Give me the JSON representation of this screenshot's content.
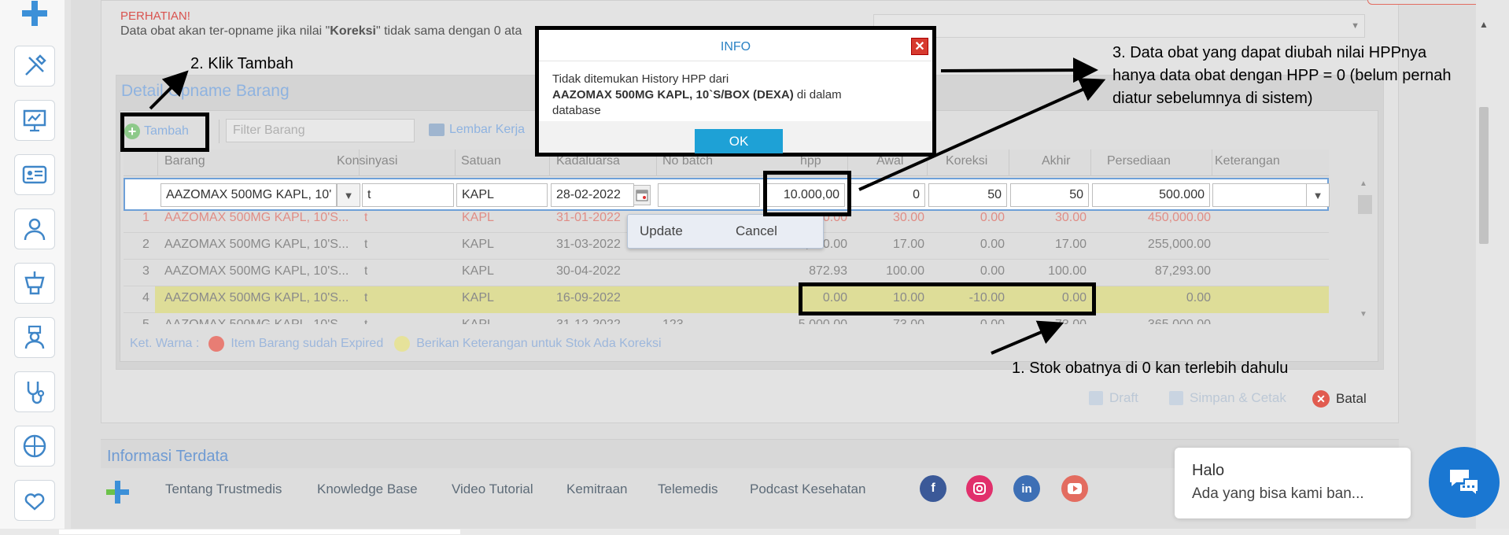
{
  "warning": {
    "title": "PERHATIAN!",
    "text_prefix": "Data obat akan ter-opname jika nilai \"",
    "text_bold": "Koreksi",
    "text_suffix": "\" tidak sama dengan 0 ata"
  },
  "detail_title": "Detail Opname Barang",
  "toolbar": {
    "add_label": "Tambah",
    "filter_placeholder": "Filter Barang",
    "worksheet_label": "Lembar Kerja"
  },
  "columns": [
    "Barang",
    "Konsinyasi",
    "Satuan",
    "Kadaluarsa",
    "No batch",
    "hpp",
    "Awal",
    "Koreksi",
    "Akhir",
    "Persediaan",
    "Keterangan"
  ],
  "edit_row": {
    "barang": "AAZOMAX 500MG KAPL, 10'",
    "konsinyasi": "t",
    "satuan": "KAPL",
    "kadaluarsa": "28-02-2022",
    "no_batch": "",
    "hpp": "10.000,00",
    "awal": "0",
    "koreksi": "50",
    "akhir": "50",
    "persediaan": "500.000",
    "keterangan": ""
  },
  "rows": [
    {
      "no": "1",
      "barang": "AAZOMAX 500MG KAPL, 10'S...",
      "konsinyasi": "t",
      "satuan": "KAPL",
      "kadaluarsa": "31-01-2022",
      "no_batch": "",
      "hpp": ",000.00",
      "awal": "30.00",
      "koreksi": "0.00",
      "akhir": "30.00",
      "persediaan": "450,000.00",
      "style": "red"
    },
    {
      "no": "2",
      "barang": "AAZOMAX 500MG KAPL, 10'S...",
      "konsinyasi": "t",
      "satuan": "KAPL",
      "kadaluarsa": "31-03-2022",
      "no_batch": "",
      "hpp": ",000.00",
      "awal": "17.00",
      "koreksi": "0.00",
      "akhir": "17.00",
      "persediaan": "255,000.00",
      "style": ""
    },
    {
      "no": "3",
      "barang": "AAZOMAX 500MG KAPL, 10'S...",
      "konsinyasi": "t",
      "satuan": "KAPL",
      "kadaluarsa": "30-04-2022",
      "no_batch": "",
      "hpp": "872.93",
      "awal": "100.00",
      "koreksi": "0.00",
      "akhir": "100.00",
      "persediaan": "87,293.00",
      "style": ""
    },
    {
      "no": "4",
      "barang": "AAZOMAX 500MG KAPL, 10'S...",
      "konsinyasi": "t",
      "satuan": "KAPL",
      "kadaluarsa": "16-09-2022",
      "no_batch": "",
      "hpp": "0.00",
      "awal": "10.00",
      "koreksi": "-10.00",
      "akhir": "0.00",
      "persediaan": "0.00",
      "style": "hl"
    },
    {
      "no": "5",
      "barang": "AAZOMAX 500MG KAPL, 10'S...",
      "konsinyasi": "t",
      "satuan": "KAPL",
      "kadaluarsa": "31-12-2022",
      "no_batch": "123",
      "hpp": "5,000.00",
      "awal": "73.00",
      "koreksi": "0.00",
      "akhir": "73.00",
      "persediaan": "365,000.00",
      "style": ""
    }
  ],
  "row_popup": {
    "update": "Update",
    "cancel": "Cancel"
  },
  "legend": {
    "label": "Ket. Warna :",
    "expired": "Item Barang sudah Expired",
    "correction": "Berikan Keterangan untuk Stok Ada Koreksi",
    "expired_color": "#e87d74",
    "correction_color": "#e6e29a"
  },
  "actions": {
    "draft": "Draft",
    "save_print": "Simpan & Cetak",
    "cancel": "Batal"
  },
  "info_section": "Informasi Terdata",
  "footer": {
    "links": [
      "Tentang Trustmedis",
      "Knowledge Base",
      "Video Tutorial",
      "Kemitraan",
      "Telemedis",
      "Podcast Kesehatan"
    ],
    "social": [
      "facebook-icon",
      "instagram-icon",
      "linkedin-icon",
      "youtube-icon"
    ]
  },
  "dialog": {
    "title": "INFO",
    "line1": "Tidak ditemukan History HPP dari",
    "item": "AAZOMAX 500MG KAPL, 10`S/BOX (DEXA)",
    "line2_suffix": " di dalam",
    "line3": "database",
    "ok": "OK"
  },
  "annotations": {
    "step1": "1. Stok obatnya di 0 kan terlebih dahulu",
    "step2": "2. Klik Tambah",
    "step3_l1": "3. Data obat yang dapat diubah nilai HPPnya",
    "step3_l2": "hanya data obat dengan HPP = 0 (belum pernah",
    "step3_l3": "diatur sebelumnya di sistem)"
  },
  "chat": {
    "greeting": "Halo",
    "message": "Ada yang bisa kami ban..."
  },
  "colors": {
    "accent": "#1ea1d6",
    "brand_blue": "#1a77d2",
    "link_blue": "#8fb3e0",
    "warning_red": "#d9534f"
  }
}
